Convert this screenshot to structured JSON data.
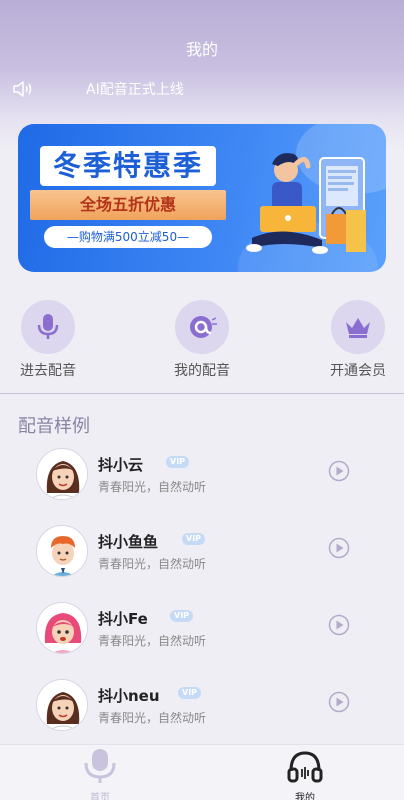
{
  "header": {
    "title": "我的",
    "notice_text": "AI配音正式上线"
  },
  "banner": {
    "title": "冬季特惠季",
    "subtitle": "全场五折优惠",
    "deal": "—购物满500立减50—"
  },
  "features": [
    {
      "label": "进去配音",
      "icon": "microphone-icon"
    },
    {
      "label": "我的配音",
      "icon": "my-voice-icon"
    },
    {
      "label": "开通会员",
      "icon": "crown-icon"
    }
  ],
  "samples_section": {
    "title": "配音样例",
    "items": [
      {
        "name": "抖小云",
        "desc": "青春阳光，自然动听",
        "badge": "VIP",
        "avatar": "female-avatar-icon"
      },
      {
        "name": "抖小鱼鱼",
        "desc": "青春阳光，自然动听",
        "badge": "VIP",
        "avatar": "boy-avatar-icon"
      },
      {
        "name": "抖小Fe",
        "desc": "青春阳光，自然动听",
        "badge": "VIP",
        "avatar": "pink-hair-avatar-icon"
      },
      {
        "name": "抖小neu",
        "desc": "青春阳光，自然动听",
        "badge": "VIP",
        "avatar": "female-avatar-icon"
      }
    ]
  },
  "bottom_nav": {
    "home_label": "首页",
    "mine_label": "我的"
  },
  "colors": {
    "accent": "#8a6fd1",
    "banner_blue": "#2f78ec",
    "icon_circle": "#dcd6ee"
  }
}
